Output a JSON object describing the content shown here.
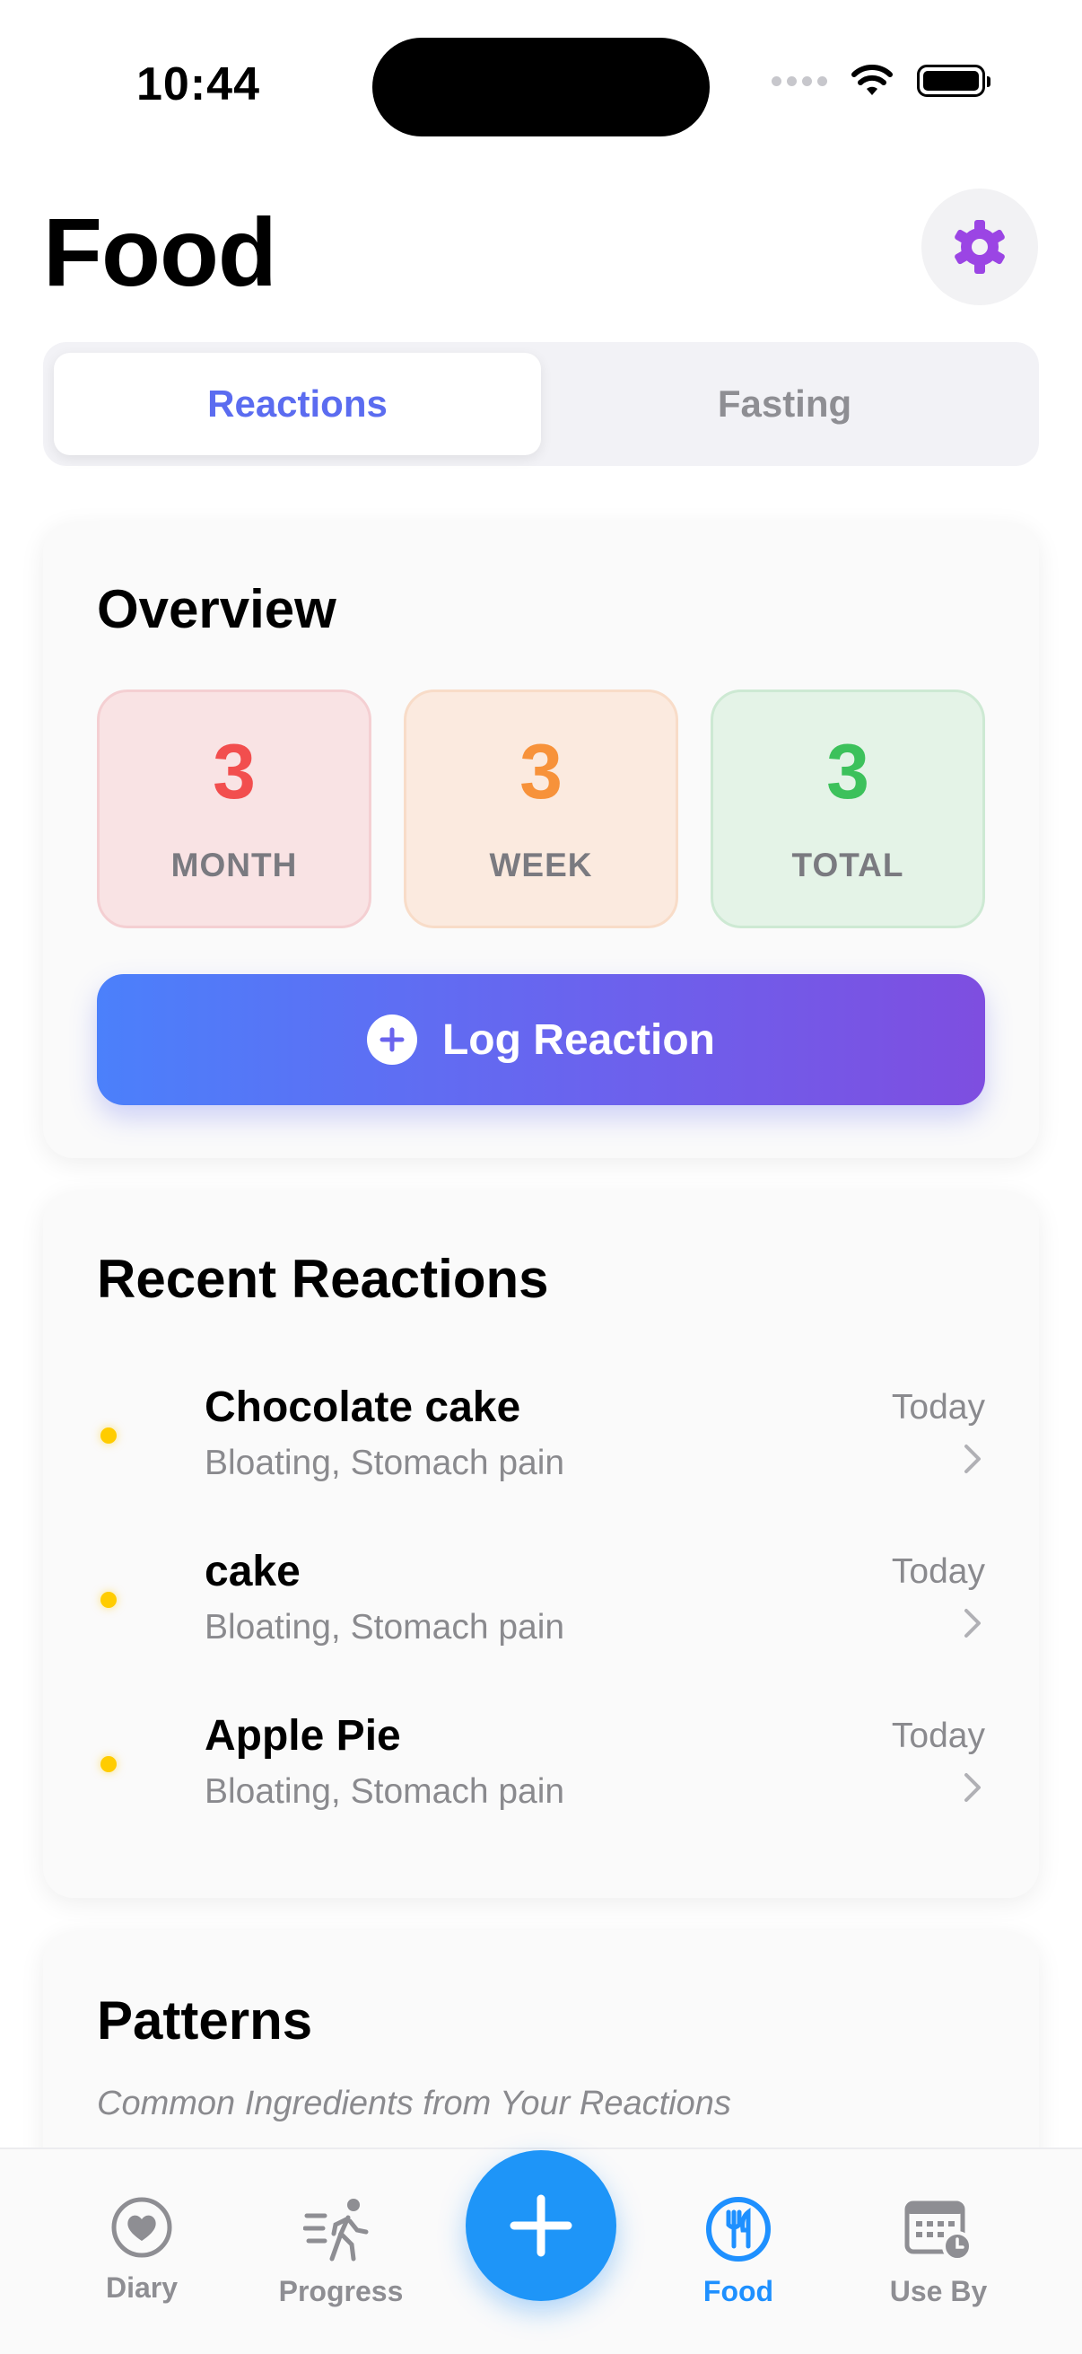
{
  "status_bar": {
    "time": "10:44"
  },
  "header": {
    "title": "Food"
  },
  "segmented": {
    "tabs": [
      {
        "label": "Reactions",
        "active": true
      },
      {
        "label": "Fasting",
        "active": false
      }
    ]
  },
  "overview": {
    "title": "Overview",
    "stats": [
      {
        "value": "3",
        "label": "MONTH",
        "color": "#f24e4e"
      },
      {
        "value": "3",
        "label": "WEEK",
        "color": "#f7923a"
      },
      {
        "value": "3",
        "label": "TOTAL",
        "color": "#3cc15b"
      }
    ],
    "log_button": "Log Reaction"
  },
  "recent": {
    "title": "Recent Reactions",
    "items": [
      {
        "food": "Chocolate cake",
        "symptoms": "Bloating, Stomach pain",
        "date": "Today"
      },
      {
        "food": "cake",
        "symptoms": "Bloating, Stomach pain",
        "date": "Today"
      },
      {
        "food": "Apple Pie",
        "symptoms": "Bloating, Stomach pain",
        "date": "Today"
      }
    ]
  },
  "patterns": {
    "title": "Patterns",
    "subtitle": "Common Ingredients from Your Reactions"
  },
  "tabbar": {
    "items": [
      {
        "label": "Diary",
        "icon": "heart-icon",
        "active": false
      },
      {
        "label": "Progress",
        "icon": "walking-icon",
        "active": false
      },
      {
        "label": "Food",
        "icon": "fork-knife-icon",
        "active": true
      },
      {
        "label": "Use By",
        "icon": "calendar-clock-icon",
        "active": false
      }
    ],
    "fab_icon": "plus-icon"
  },
  "colors": {
    "accent": "#1e90ff",
    "segment_active": "#5b6cf0",
    "settings_icon": "#9b45e4",
    "dot": "#ffcc00"
  }
}
